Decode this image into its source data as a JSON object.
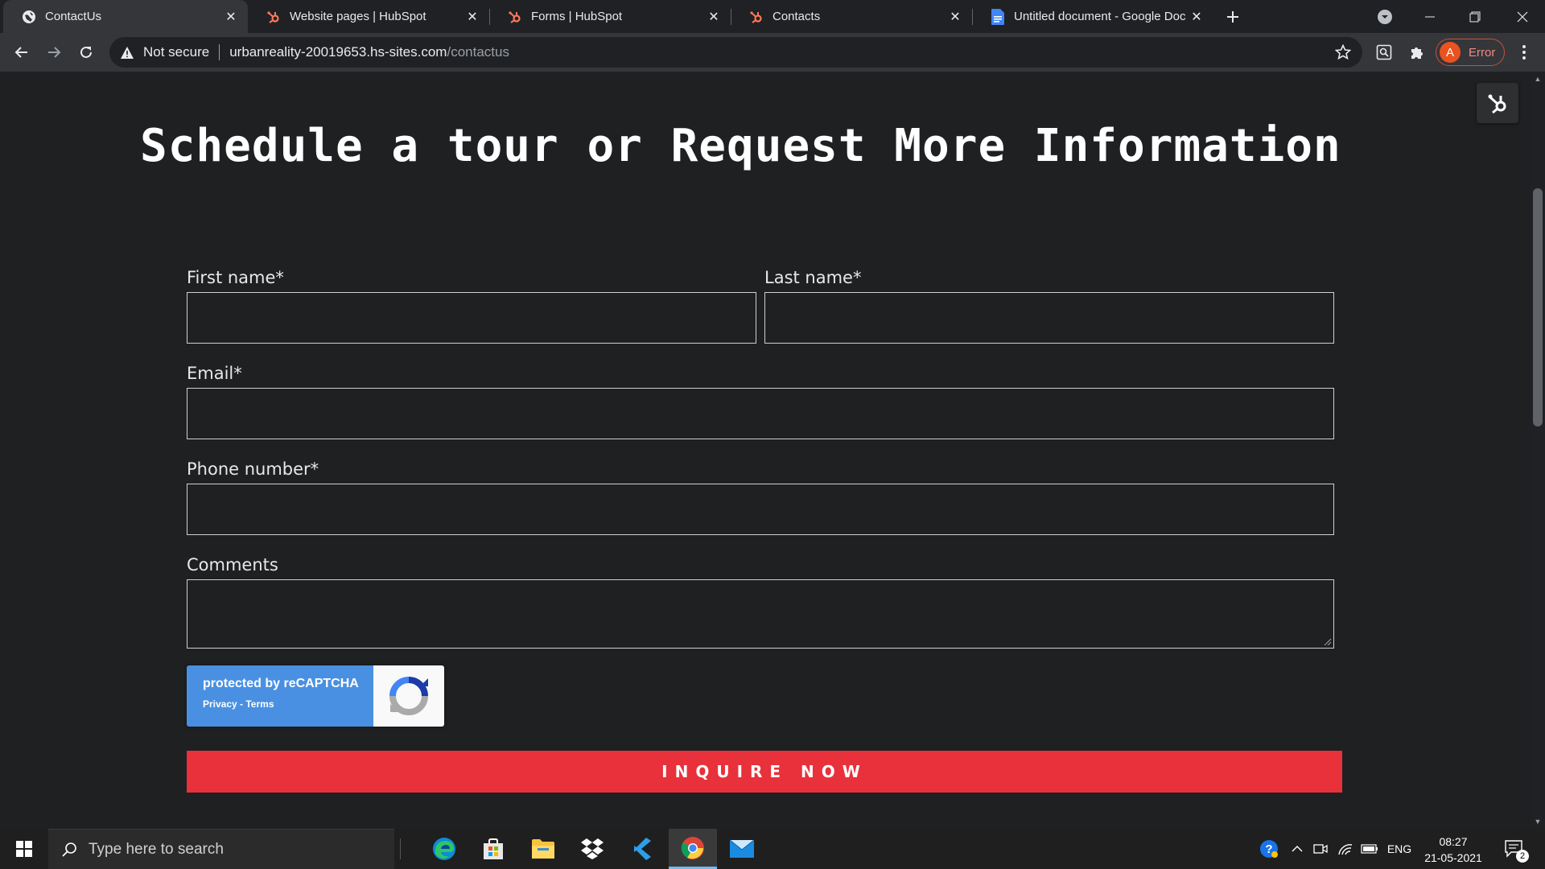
{
  "browser": {
    "tabs": [
      {
        "title": "ContactUs",
        "favicon": "globe-icon",
        "active": true
      },
      {
        "title": "Website pages | HubSpot",
        "favicon": "hubspot-icon",
        "active": false
      },
      {
        "title": "Forms | HubSpot",
        "favicon": "hubspot-icon",
        "active": false
      },
      {
        "title": "Contacts",
        "favicon": "hubspot-icon",
        "active": false
      },
      {
        "title": "Untitled document - Google Doc",
        "favicon": "google-docs-icon",
        "active": false
      }
    ],
    "security_label": "Not secure",
    "url_domain": "urbanreality-20019653.hs-sites.com",
    "url_path": "/contactus",
    "profile_initial": "A",
    "profile_status": "Error"
  },
  "page": {
    "heading": "Schedule a tour or Request More Information",
    "form": {
      "first_name_label": "First name*",
      "last_name_label": "Last name*",
      "email_label": "Email*",
      "phone_label": "Phone number*",
      "comments_label": "Comments",
      "first_name_value": "",
      "last_name_value": "",
      "email_value": "",
      "phone_value": "",
      "comments_value": "",
      "recaptcha_text": "protected by reCAPTCHA",
      "recaptcha_links": "Privacy - Terms",
      "submit_label": "INQUIRE NOW"
    }
  },
  "taskbar": {
    "search_placeholder": "Type here to search",
    "apps": [
      "edge-icon",
      "store-icon",
      "file-explorer-icon",
      "dropbox-icon",
      "vscode-icon",
      "chrome-icon",
      "mail-icon"
    ],
    "language": "ENG",
    "time": "08:27",
    "date": "21-05-2021",
    "notification_count": "2"
  },
  "colors": {
    "page_background": "#1e2022",
    "submit_button": "#e8313a",
    "recaptcha_blue": "#4a90e2",
    "hubspot_orange": "#ff7a59"
  }
}
